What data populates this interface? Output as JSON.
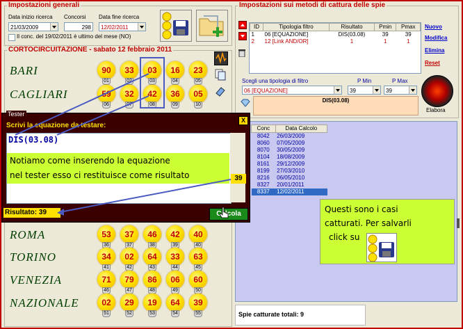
{
  "general": {
    "title": "Impostazioni generali",
    "start_label": "Data inizio ricerca",
    "start_value": "21/03/2009",
    "contests_label": "Concorsi",
    "contests_value": "298",
    "end_label": "Data fine ricerca",
    "end_value": "12/02/2011",
    "checkbox_label": "Il conc. del 19/02/2011 è ultimo del mese (NO)"
  },
  "draw": {
    "title": "CORTOCIRCUITAZIONE - sabato 12 febbraio 2011",
    "wheels": [
      {
        "name": "BARI",
        "nums": [
          "90",
          "33",
          "03",
          "16",
          "23"
        ],
        "pos": [
          "01",
          "02",
          "03",
          "04",
          "05"
        ]
      },
      {
        "name": "CAGLIARI",
        "nums": [
          "59",
          "32",
          "42",
          "36",
          "05"
        ],
        "pos": [
          "06",
          "07",
          "08",
          "09",
          "10"
        ]
      },
      {
        "name": "ROMA",
        "nums": [
          "53",
          "37",
          "46",
          "42",
          "40"
        ],
        "pos": [
          "36",
          "37",
          "38",
          "39",
          "40"
        ]
      },
      {
        "name": "TORINO",
        "nums": [
          "34",
          "02",
          "64",
          "33",
          "63"
        ],
        "pos": [
          "41",
          "42",
          "43",
          "44",
          "45"
        ]
      },
      {
        "name": "VENEZIA",
        "nums": [
          "71",
          "79",
          "86",
          "06",
          "60"
        ],
        "pos": [
          "46",
          "47",
          "48",
          "49",
          "50"
        ]
      },
      {
        "name": "NAZIONALE",
        "nums": [
          "02",
          "29",
          "19",
          "64",
          "39"
        ],
        "pos": [
          "51",
          "52",
          "53",
          "54",
          "55"
        ]
      }
    ]
  },
  "tester": {
    "title": "Tester",
    "close": "X",
    "prompt": "Scrivi la equazione da testare:",
    "equation": "DIS(03.08)",
    "result_label": "Risultato: 39",
    "calc_button": "Calcola",
    "result_marker": "39"
  },
  "callouts": {
    "tester_line1": "Notiamo come inserendo la equazione",
    "tester_line2": "nel tester esso ci restituisce come risultato",
    "captured_line1": "Questi sono i casi",
    "captured_line2": "catturati. Per salvarli",
    "captured_line3": "click su"
  },
  "methods": {
    "title": "Impostazioni sui metodi di cattura delle spie",
    "headers": [
      "ID",
      "Tipologia filtro",
      "Risultato",
      "Pmin",
      "Pmax"
    ],
    "rows": [
      {
        "id": "1",
        "tipo": "06 [EQUAZIONE]",
        "ris": "DIS(03.08)",
        "pmin": "39",
        "pmax": "39"
      },
      {
        "id": "2",
        "tipo": "12 [Link AND/OR]",
        "ris": "1",
        "pmin": "1",
        "pmax": "1"
      }
    ],
    "links": {
      "new": "Nuovo",
      "edit": "Modifica",
      "delete": "Elimina",
      "reset": "Reset"
    },
    "filter_label": "Scegli una tipologia di filtro",
    "filter_value": "06 [EQUAZIONE]",
    "pmin_label": "P Min",
    "pmin_value": "39",
    "pmax_label": "P Max",
    "pmax_value": "39",
    "result_display": "DIS(03.08)",
    "elabora": "Elabora"
  },
  "captured": {
    "headers": [
      "Conc",
      "Data Calcolo"
    ],
    "rows": [
      [
        "8042",
        "26/03/2009"
      ],
      [
        "8060",
        "07/05/2009"
      ],
      [
        "8070",
        "30/05/2009"
      ],
      [
        "8104",
        "18/08/2009"
      ],
      [
        "8161",
        "29/12/2009"
      ],
      [
        "8199",
        "27/03/2010"
      ],
      [
        "8216",
        "06/05/2010"
      ],
      [
        "8327",
        "20/01/2011"
      ],
      [
        "8337",
        "12/02/2011"
      ]
    ],
    "total_label": "Spie catturate totali: 9"
  },
  "colors": {
    "accent": "#c00000",
    "callout": "#ccff33",
    "grid_bg": "#c8c8f0",
    "selected_row": "#316ac5",
    "tester_bg": "#3a0000"
  }
}
